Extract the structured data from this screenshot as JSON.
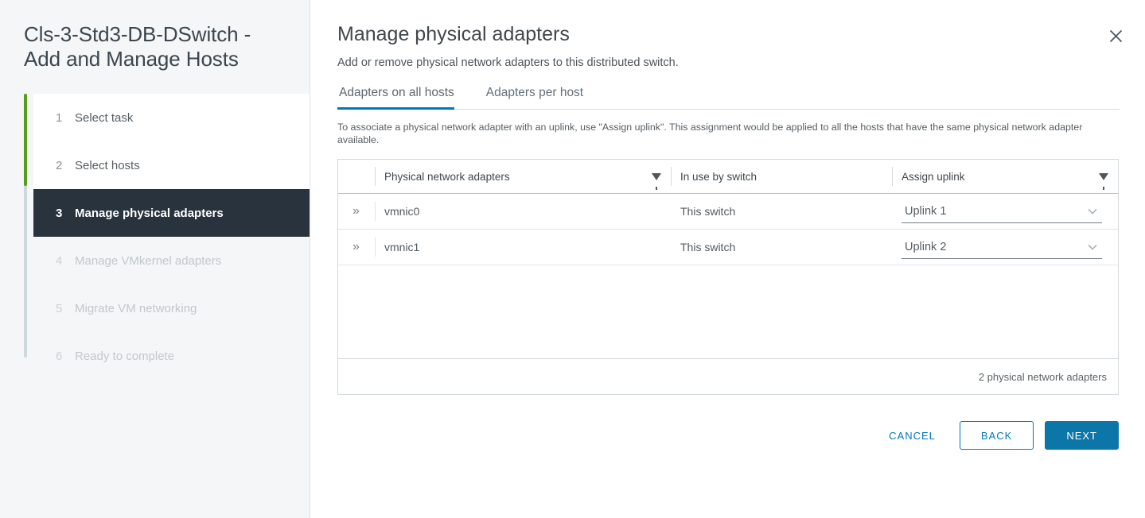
{
  "sidebar": {
    "title": "Cls-3-Std3-DB-DSwitch - Add and Manage Hosts",
    "steps": [
      {
        "num": "1",
        "label": "Select task",
        "state": "done"
      },
      {
        "num": "2",
        "label": "Select hosts",
        "state": "done"
      },
      {
        "num": "3",
        "label": "Manage physical adapters",
        "state": "active"
      },
      {
        "num": "4",
        "label": "Manage VMkernel adapters",
        "state": "disabled"
      },
      {
        "num": "5",
        "label": "Migrate VM networking",
        "state": "disabled"
      },
      {
        "num": "6",
        "label": "Ready to complete",
        "state": "disabled"
      }
    ]
  },
  "header": {
    "title": "Manage physical adapters",
    "subtitle": "Add or remove physical network adapters to this distributed switch.",
    "close_icon": "close-icon"
  },
  "tabs": [
    {
      "label": "Adapters on all hosts",
      "active": true
    },
    {
      "label": "Adapters per host",
      "active": false
    }
  ],
  "info_text": "To associate a physical network adapter with an uplink, use \"Assign uplink\". This assignment would be applied to all the hosts that have the same physical network adapter available.",
  "table": {
    "columns": [
      {
        "label": "Physical network adapters",
        "filter": true
      },
      {
        "label": "In use by switch",
        "filter": false
      },
      {
        "label": "Assign uplink",
        "filter": true
      }
    ],
    "rows": [
      {
        "expand": "»",
        "adapter": "vmnic0",
        "in_use_by_switch": "This switch",
        "assign_uplink": "Uplink 1",
        "chevron": "⌄"
      },
      {
        "expand": "»",
        "adapter": "vmnic1",
        "in_use_by_switch": "This switch",
        "assign_uplink": "Uplink 2",
        "chevron": "⌄"
      }
    ],
    "footer_count": "2 physical network adapters"
  },
  "actions": {
    "cancel": "CANCEL",
    "back": "BACK",
    "next": "NEXT"
  },
  "colors": {
    "accent_blue": "#0079b8",
    "next_blue": "#0d76a8",
    "progress_green": "#5a9c1c",
    "active_step_bg": "#29333e"
  }
}
